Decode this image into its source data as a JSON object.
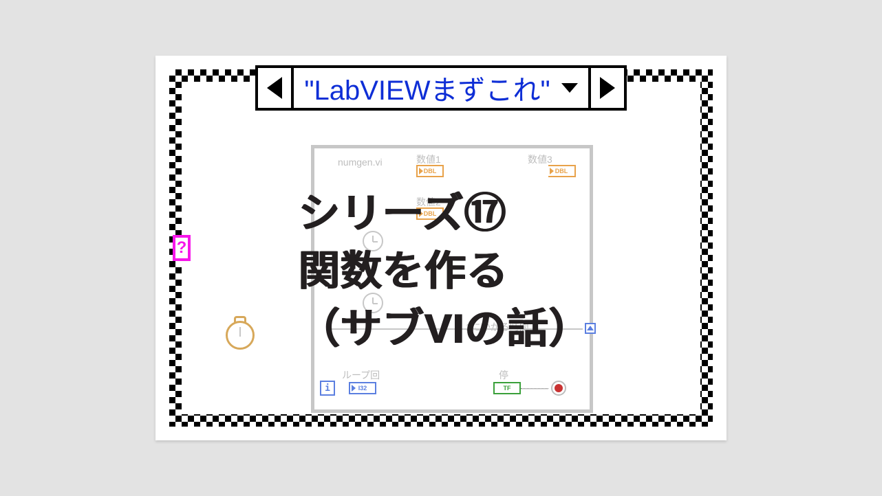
{
  "case_selector": {
    "text": "\"LabVIEWまずこれ\""
  },
  "question_terminal": "?",
  "overlay": {
    "line1": "シリーズ⑰",
    "line2": "関数を作る",
    "line3": "（サブVIの話）"
  },
  "subvi_label": "numgen.vi",
  "indicators": {
    "n1": "数値1",
    "n2": "数値2",
    "n3": "数値3",
    "loop_count": "ループ回",
    "stop": "停",
    "loop_time": "1にかかる時間"
  },
  "terminals": {
    "dbl": "DBL",
    "i32": "I32",
    "tf": "TF",
    "i": "i"
  }
}
